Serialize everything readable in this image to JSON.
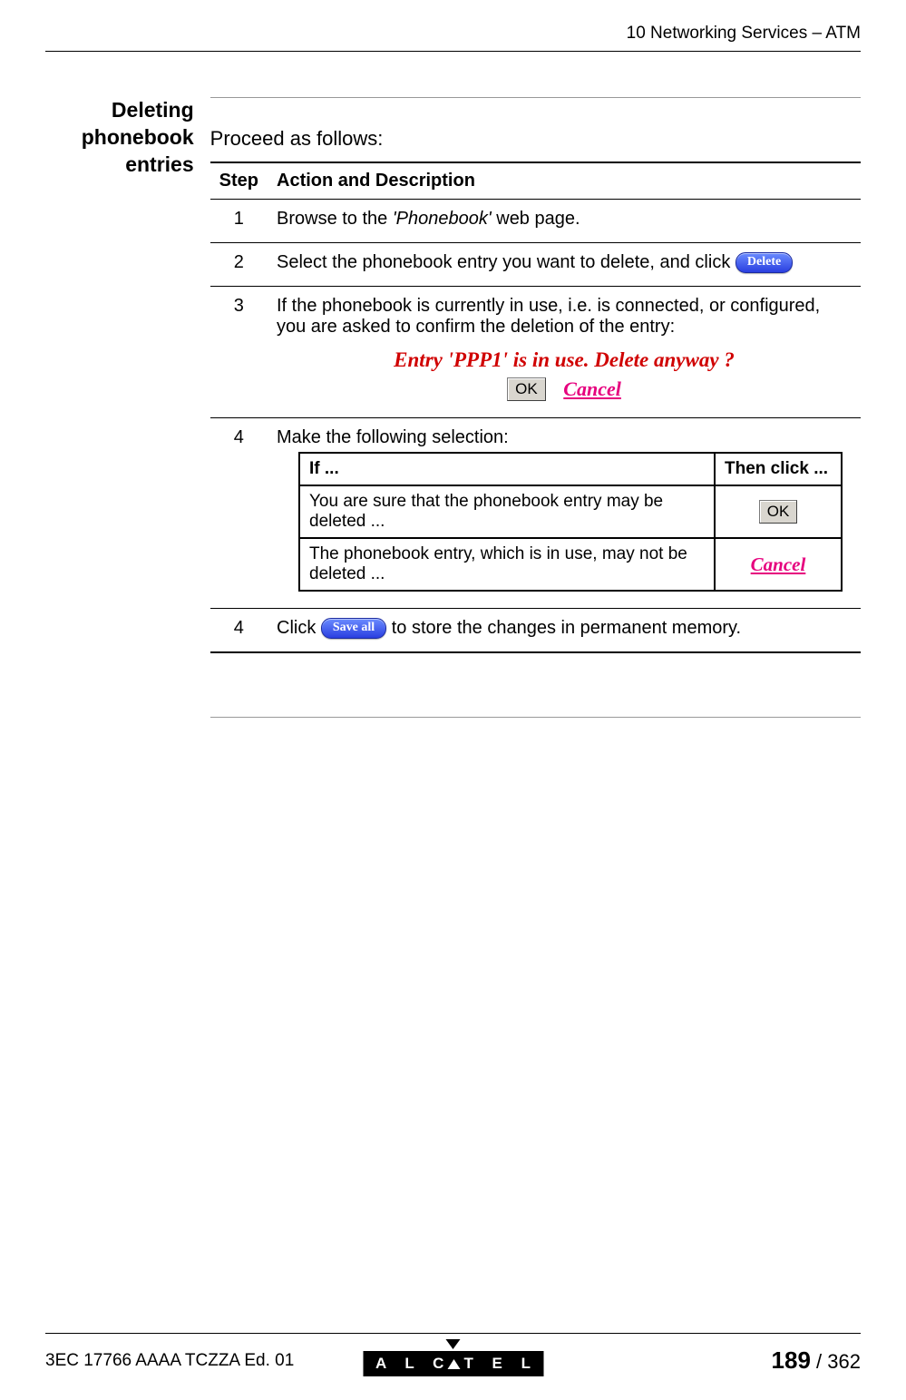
{
  "header": {
    "running": "10 Networking Services – ATM"
  },
  "section": {
    "sidehead_line1": "Deleting phonebook",
    "sidehead_line2": "entries",
    "intro": "Proceed as follows:"
  },
  "table": {
    "headers": {
      "step": "Step",
      "action": "Action and Description"
    },
    "rows": [
      {
        "num": "1",
        "text_pre": "Browse to the ",
        "text_em": "'Phonebook'",
        "text_post": " web page."
      },
      {
        "num": "2",
        "text": "Select the phonebook entry you want to delete, and click ",
        "button": "Delete"
      },
      {
        "num": "3",
        "text": "If the phonebook is currently in use, i.e. is connected, or configured, you are asked to confirm the deletion of the entry:",
        "prompt": "Entry 'PPP1' is in use. Delete anyway ?",
        "ok": "OK",
        "cancel": "Cancel"
      },
      {
        "num": "4",
        "text": "Make the following selection:",
        "inner": {
          "h1": "If ...",
          "h2": "Then click ...",
          "r1c1": "You are sure that the phonebook entry may be deleted ...",
          "r1_ok": "OK",
          "r2c1": "The phonebook entry, which is in use, may not be deleted ...",
          "r2_cancel": "Cancel"
        }
      },
      {
        "num": "4",
        "text_pre": "Click ",
        "button": "Save all",
        "text_post": " to store the changes in permanent memory."
      }
    ]
  },
  "footer": {
    "docid": "3EC 17766 AAAA TCZZA Ed. 01",
    "page_current": "189",
    "page_sep": " / ",
    "page_total": "362",
    "brand": "ALCATEL"
  }
}
